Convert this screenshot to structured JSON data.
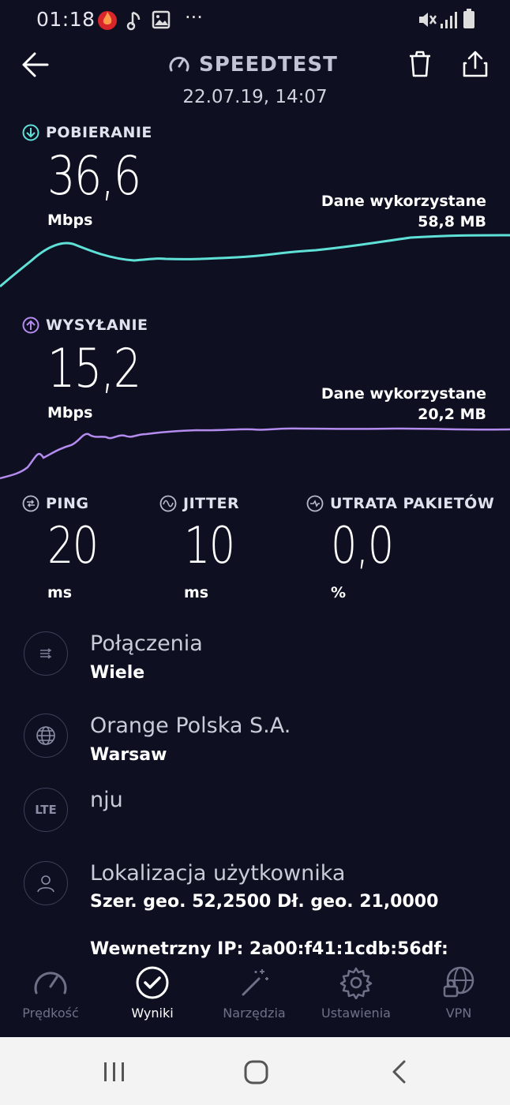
{
  "status_bar": {
    "time": "01:18",
    "more": "···"
  },
  "header": {
    "title": "SPEEDTEST",
    "date": "22.07.19, 14:07"
  },
  "download": {
    "label": "POBIERANIE",
    "value": "36,6",
    "unit": "Mbps",
    "data_used_label": "Dane wykorzystane",
    "data_used_value": "58,8 MB"
  },
  "upload": {
    "label": "WYSYŁANIE",
    "value": "15,2",
    "unit": "Mbps",
    "data_used_label": "Dane wykorzystane",
    "data_used_value": "20,2 MB"
  },
  "stats": [
    {
      "label": "PING",
      "value": "20",
      "unit": "ms"
    },
    {
      "label": "JITTER",
      "value": "10",
      "unit": "ms"
    },
    {
      "label": "UTRATA PAKIETÓW",
      "value": "0,0",
      "unit": "%"
    }
  ],
  "info": [
    {
      "icon": "connections-icon",
      "title": "Połączenia",
      "subtitle": "Wiele"
    },
    {
      "icon": "globe-icon",
      "title": "Orange Polska S.A.",
      "subtitle": "Warsaw"
    },
    {
      "icon": "lte-icon",
      "badge": "LTE",
      "title": "nju",
      "subtitle": ""
    },
    {
      "icon": "user-icon",
      "title": "Lokalizacja użytkownika",
      "subtitle": "Szer. geo. 52,2500 Dł. geo. 21,0000"
    }
  ],
  "internal_ip": "Wewnetrzny IP: 2a00:f41:1cdb:56df:",
  "nav": [
    {
      "label": "Prędkość",
      "icon": "speed-gauge-icon"
    },
    {
      "label": "Wyniki",
      "icon": "check-circle-icon"
    },
    {
      "label": "Narzędzia",
      "icon": "magic-wand-icon"
    },
    {
      "label": "Ustawienia",
      "icon": "gear-icon"
    },
    {
      "label": "VPN",
      "icon": "vpn-globe-lock-icon"
    }
  ],
  "colors": {
    "background": "#0e1021",
    "download": "#5fe1d8",
    "upload": "#b48cf0",
    "muted": "#6e7088"
  }
}
